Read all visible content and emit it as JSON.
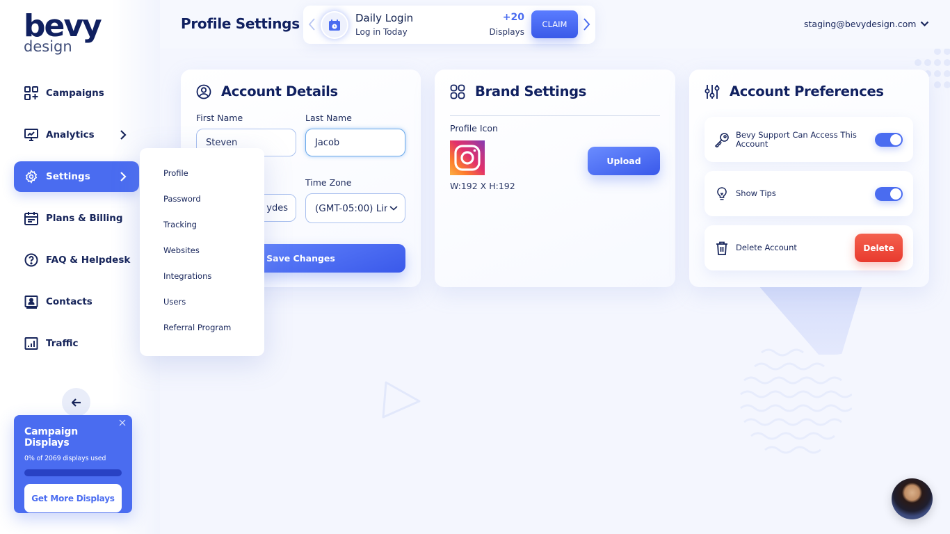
{
  "brand": {
    "name_top": "bevy",
    "name_bottom": "design"
  },
  "header": {
    "title": "Profile Settings",
    "daily_login": {
      "title": "Daily Login",
      "subtitle": "Log in Today",
      "points": "+20",
      "points_label": "Displays",
      "claim_label": "CLAIM"
    },
    "user_email": "staging@bevydesign.com"
  },
  "sidebar": {
    "items": [
      {
        "label": "Campaigns",
        "icon": "campaigns-icon",
        "has_chevron": false,
        "active": false
      },
      {
        "label": "Analytics",
        "icon": "analytics-icon",
        "has_chevron": true,
        "active": false
      },
      {
        "label": "Settings",
        "icon": "gear-icon",
        "has_chevron": true,
        "active": true
      },
      {
        "label": "Plans & Billing",
        "icon": "calendar-icon",
        "has_chevron": false,
        "active": false
      },
      {
        "label": "FAQ & Helpdesk",
        "icon": "help-icon",
        "has_chevron": false,
        "active": false
      },
      {
        "label": "Contacts",
        "icon": "contacts-icon",
        "has_chevron": false,
        "active": false
      },
      {
        "label": "Traffic",
        "icon": "traffic-icon",
        "has_chevron": false,
        "active": false
      }
    ],
    "displays_card": {
      "title": "Campaign Displays",
      "usage_text": "0% of 2069 displays used",
      "usage_percent": 0,
      "cta_label": "Get More Displays"
    }
  },
  "settings_submenu": {
    "items": [
      "Profile",
      "Password",
      "Tracking",
      "Websites",
      "Integrations",
      "Users",
      "Referral Program"
    ]
  },
  "account_details": {
    "title": "Account Details",
    "first_name_label": "First Name",
    "first_name_value": "Steven",
    "last_name_label": "Last Name",
    "last_name_value": "Jacob",
    "email_value_partial": "ydes",
    "timezone_label": "Time Zone",
    "timezone_value": "(GMT-05:00) Lir",
    "save_label": "Save Changes"
  },
  "brand_settings": {
    "title": "Brand Settings",
    "profile_icon_label": "Profile Icon",
    "dimensions": "W:192 X H:192",
    "upload_label": "Upload"
  },
  "account_preferences": {
    "title": "Account Preferences",
    "support_access_label": "Bevy Support Can Access This Account",
    "support_access_on": true,
    "show_tips_label": "Show Tips",
    "show_tips_on": true,
    "delete_account_label": "Delete Account",
    "delete_button_label": "Delete"
  },
  "colors": {
    "accent": "#4a6cf0",
    "navy": "#102060",
    "danger": "#e83a2e"
  }
}
